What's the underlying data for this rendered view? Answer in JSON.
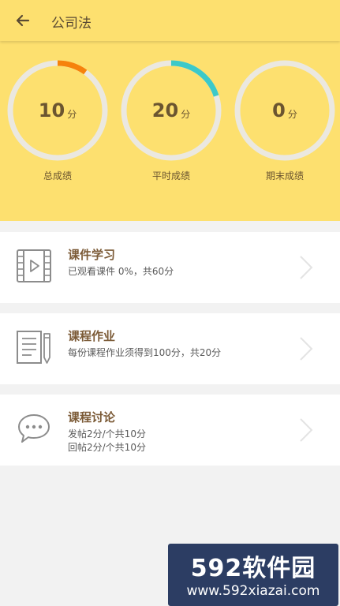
{
  "header": {
    "title": "公司法",
    "back_icon": "back-arrow-icon"
  },
  "scores": [
    {
      "value": "10",
      "unit": "分",
      "label": "总成绩",
      "progress": 0.1,
      "color": "#f6820c"
    },
    {
      "value": "20",
      "unit": "分",
      "label": "平时成绩",
      "progress": 0.2,
      "color": "#3cc9c9"
    },
    {
      "value": "0",
      "unit": "分",
      "label": "期末成绩",
      "progress": 0.0,
      "color": "#3cc9c9"
    }
  ],
  "items": [
    {
      "title": "课件学习",
      "lines": [
        "已观看课件 0%，共60分"
      ],
      "icon": "video-icon"
    },
    {
      "title": "课程作业",
      "lines": [
        "每份课程作业须得到100分，共20分"
      ],
      "icon": "homework-icon"
    },
    {
      "title": "课程讨论",
      "lines": [
        "发帖2分/个共10分",
        "回帖2分/个共10分"
      ],
      "icon": "chat-icon"
    }
  ],
  "watermark": {
    "brand": "592软件园",
    "url": "www.592xiazai.com"
  },
  "colors": {
    "header_bg": "#fde06f",
    "title_text": "#7b5a36",
    "ring_track": "#ebe8e0"
  }
}
